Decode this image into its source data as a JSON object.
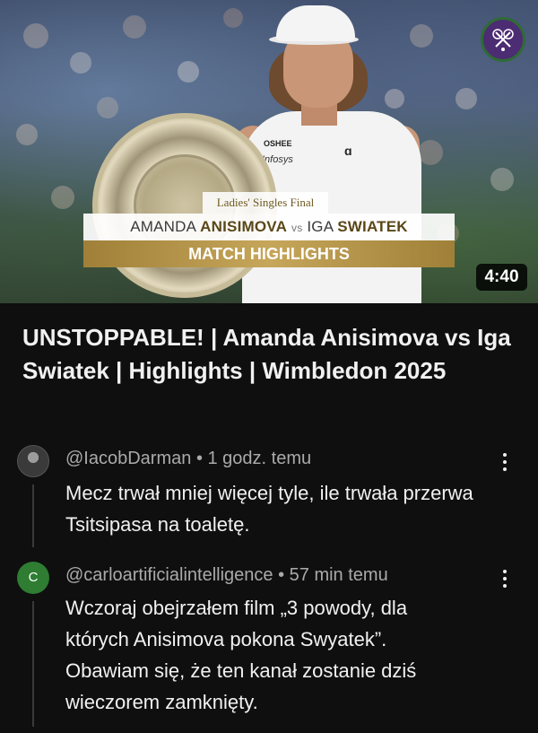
{
  "video": {
    "overlay_line1": "Ladies' Singles Final",
    "player1_first": "AMANDA",
    "player1_last": "ANISIMOVA",
    "vs": "vs",
    "player2_first": "IGA",
    "player2_last": "SWIATEK",
    "overlay_line3": "MATCH HIGHLIGHTS",
    "duration": "4:40",
    "sponsor_shirt": "OSHEE",
    "sponsor_shirt2": "Infosys",
    "brand_logo_icon": "wimbledon-crossed-rackets",
    "accent_color": "#b39245"
  },
  "title": "UNSTOPPABLE! | Amanda Anisimova vs Iga Swiatek | Highlights | Wimbledon 2025",
  "comments": [
    {
      "author": "@IacobDarman",
      "time": "1 godz. temu",
      "text": "Mecz trwał mniej więcej tyle, ile trwała przerwa Tsitsipasa na toaletę.",
      "avatar_type": "photo"
    },
    {
      "author": "@carloartificialintelligence",
      "time": "57 min temu",
      "text": "Wczoraj obejrzałem film „3 powody, dla których Anisimova pokona Swyatek”. Obawiam się, że ten kanał zostanie dziś wieczorem zamknięty.",
      "avatar_letter": "C",
      "avatar_color": "#2e7d32"
    }
  ],
  "colors": {
    "background": "#0f0f0f",
    "text_primary": "#f1f1f1",
    "text_secondary": "#aaaaaa"
  }
}
